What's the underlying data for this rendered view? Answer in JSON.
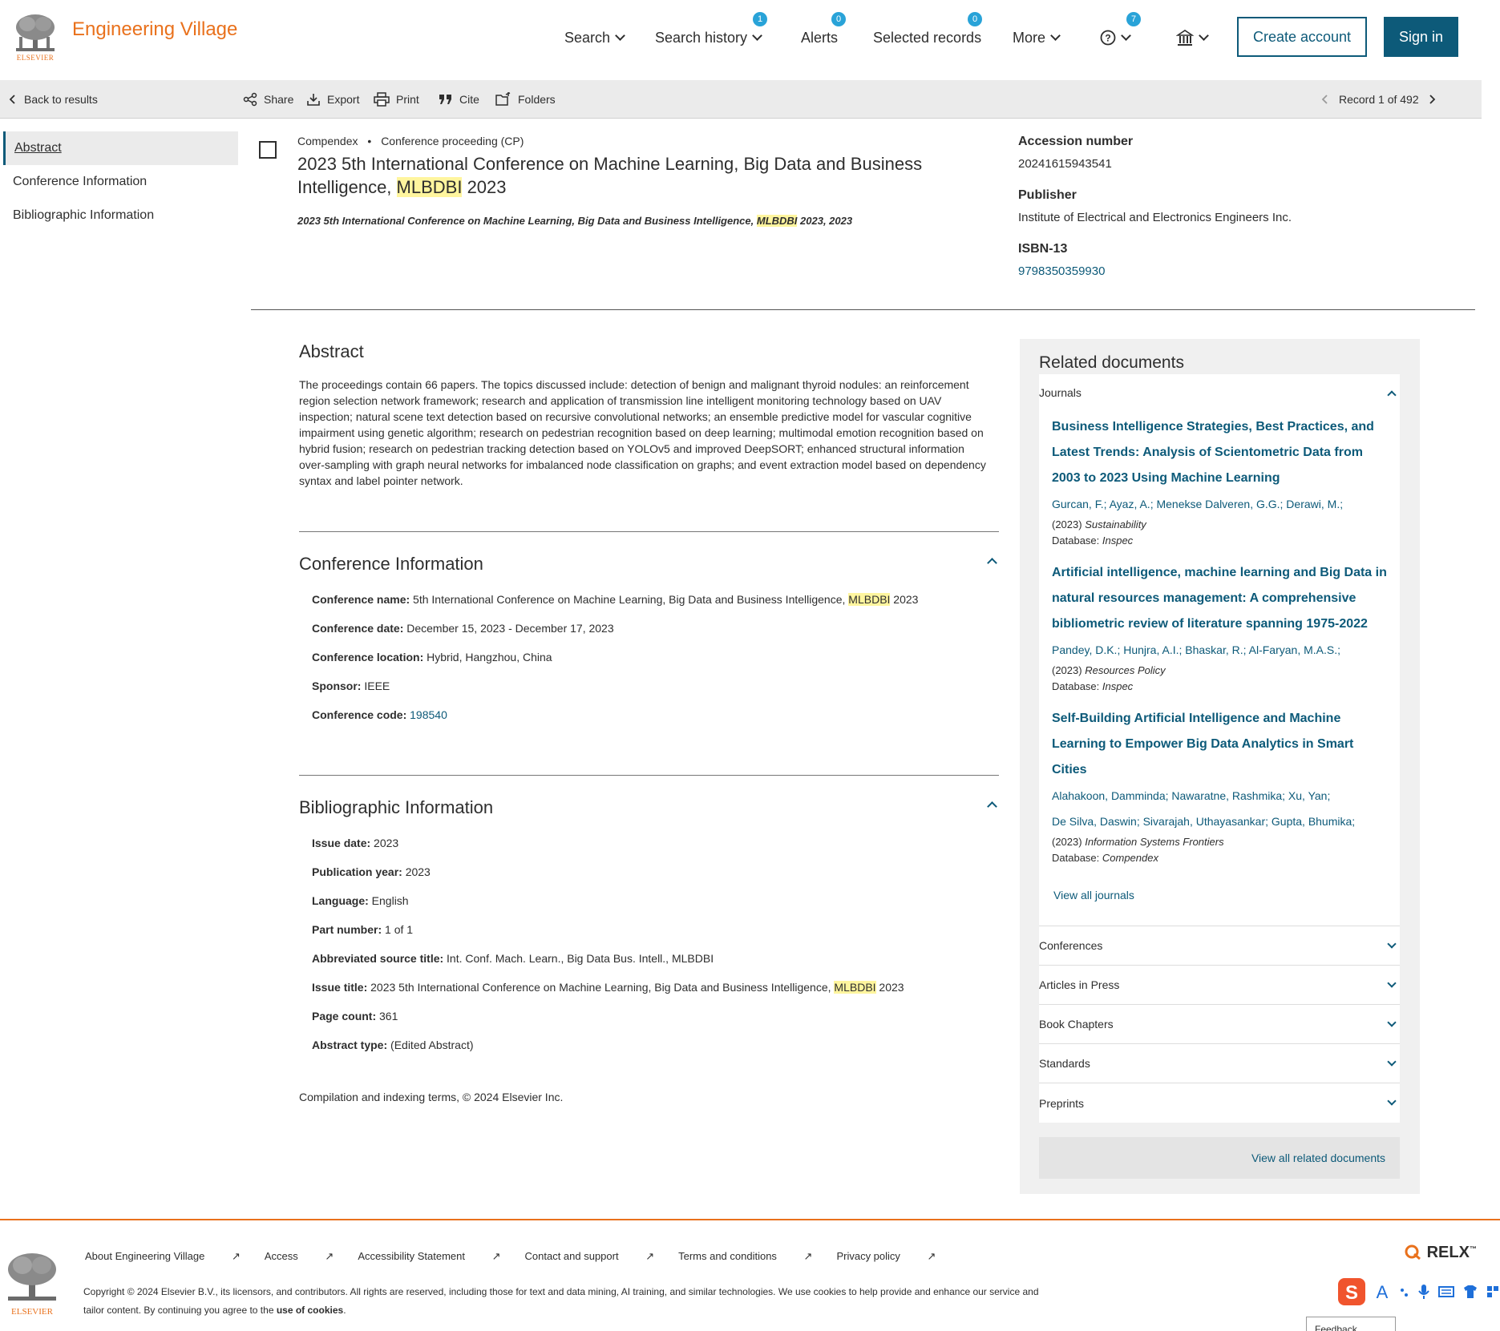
{
  "header": {
    "publisher_logo_text": "ELSEVIER",
    "brand": "Engineering Village",
    "nav": [
      {
        "label": "Search",
        "badge": null
      },
      {
        "label": "Search history",
        "badge": "1"
      },
      {
        "label": "Alerts",
        "badge": "0"
      },
      {
        "label": "Selected records",
        "badge": "0"
      },
      {
        "label": "More",
        "badge": null
      }
    ],
    "help_badge": "7",
    "create_account": "Create account",
    "sign_in": "Sign in"
  },
  "toolbar": {
    "back": "Back to results",
    "share": "Share",
    "export": "Export",
    "print": "Print",
    "cite": "Cite",
    "folders": "Folders",
    "record": "Record 1 of 492"
  },
  "sidebar": {
    "items": [
      {
        "label": "Abstract",
        "active": true
      },
      {
        "label": "Conference Information",
        "active": false
      },
      {
        "label": "Bibliographic Information",
        "active": false
      }
    ]
  },
  "record": {
    "database": "Compendex",
    "doc_type": "Conference proceeding (CP)",
    "title_pre": "2023 5th International Conference on Machine Learning, Big Data and Business Intelligence, ",
    "title_hl": "MLBDBI",
    "title_post": " 2023",
    "source_pre": "2023 5th International Conference on Machine Learning, Big Data and Business Intelligence, ",
    "source_hl": "MLBDBI",
    "source_post": " 2023, 2023",
    "accession_label": "Accession number",
    "accession": "20241615943541",
    "publisher_label": "Publisher",
    "publisher": "Institute of Electrical and Electronics Engineers Inc.",
    "isbn_label": "ISBN-13",
    "isbn": "9798350359930"
  },
  "abstract": {
    "heading": "Abstract",
    "text": "The proceedings contain 66 papers. The topics discussed include: detection of benign and malignant thyroid nodules: an reinforcement region selection network framework; research and application of transmission line intelligent monitoring technology based on UAV inspection; natural scene text detection based on recursive convolutional networks; an ensemble predictive model for vascular cognitive impairment using genetic algorithm; research on pedestrian recognition based on deep learning; multimodal emotion recognition based on hybrid fusion; research on pedestrian tracking detection based on YOLOv5 and improved DeepSORT; enhanced structural information over-sampling with graph neural networks for imbalanced node classification on graphs; and event extraction model based on dependency syntax and label pointer network."
  },
  "conference": {
    "heading": "Conference Information",
    "name_label": "Conference name:",
    "name_pre": "5th International Conference on Machine Learning, Big Data and Business Intelligence, ",
    "name_hl": "MLBDBI",
    "name_post": " 2023",
    "date_label": "Conference date:",
    "date": "December 15, 2023 - December 17, 2023",
    "location_label": "Conference location:",
    "location": "Hybrid, Hangzhou, China",
    "sponsor_label": "Sponsor:",
    "sponsor": "IEEE",
    "code_label": "Conference code:",
    "code": "198540"
  },
  "bibliographic": {
    "heading": "Bibliographic Information",
    "issue_date_label": "Issue date:",
    "issue_date": "2023",
    "pub_year_label": "Publication year:",
    "pub_year": "2023",
    "language_label": "Language:",
    "language": "English",
    "part_label": "Part number:",
    "part": "1 of 1",
    "abbr_label": "Abbreviated source title:",
    "abbr": "Int. Conf. Mach. Learn., Big Data Bus. Intell., MLBDBI",
    "issue_title_label": "Issue title:",
    "issue_title_pre": "2023 5th International Conference on Machine Learning, Big Data and Business Intelligence, ",
    "issue_title_hl": "MLBDBI",
    "issue_title_post": " 2023",
    "page_count_label": "Page count:",
    "page_count": "361",
    "abstract_type_label": "Abstract type:",
    "abstract_type": "(Edited Abstract)"
  },
  "copyright_line": "Compilation and indexing terms, © 2024 Elsevier Inc.",
  "related": {
    "heading": "Related documents",
    "journals_label": "Journals",
    "docs": [
      {
        "title": "Business Intelligence Strategies, Best Practices, and Latest Trends: Analysis of Scientometric Data from 2003 to 2023 Using Machine Learning",
        "authors1": "Gurcan, F.;  Ayaz, A.;  Menekse Dalveren, G.G.;  Derawi, M.;",
        "authors2": "",
        "year": "(2023) ",
        "journal": "Sustainability",
        "db_label": "Database: ",
        "db": "Inspec"
      },
      {
        "title": "Artificial intelligence, machine learning and Big Data in natural resources management: A comprehensive bibliometric review of literature spanning 1975-2022",
        "authors1": "Pandey, D.K.;  Hunjra, A.I.;  Bhaskar, R.;  Al-Faryan, M.A.S.;",
        "authors2": "",
        "year": "(2023) ",
        "journal": "Resources Policy",
        "db_label": "Database: ",
        "db": "Inspec"
      },
      {
        "title": "Self-Building Artificial Intelligence and Machine Learning to Empower Big Data Analytics in Smart Cities",
        "authors1": "Alahakoon, Damminda;  Nawaratne, Rashmika;  Xu, Yan;",
        "authors2": "De Silva, Daswin;  Sivarajah, Uthayasankar;  Gupta, Bhumika;",
        "year": "(2023) ",
        "journal": "Information Systems Frontiers",
        "db_label": "Database: ",
        "db": "Compendex"
      }
    ],
    "view_all_journals": "View all journals",
    "sections": [
      "Conferences",
      "Articles in Press",
      "Book Chapters",
      "Standards",
      "Preprints"
    ],
    "view_all_related": "View all related documents"
  },
  "footer": {
    "links": [
      "About Engineering Village",
      "Access",
      "Accessibility Statement",
      "Contact and support",
      "Terms and conditions",
      "Privacy policy"
    ],
    "copyright_pre": "Copyright © 2024 Elsevier B.V., its licensors, and contributors. All rights are reserved, including those for text and data mining, AI training, and similar technologies. We use cookies to help provide and enhance our service and tailor content. By continuing you agree to the ",
    "cookies": "use of cookies",
    "copyright_post": ".",
    "relx": "RELX",
    "feedback": "Feedback"
  },
  "colors": {
    "brand_orange": "#e9711c",
    "primary": "#0d5a79",
    "highlight": "#fff59e",
    "badge": "#29a3d8"
  }
}
